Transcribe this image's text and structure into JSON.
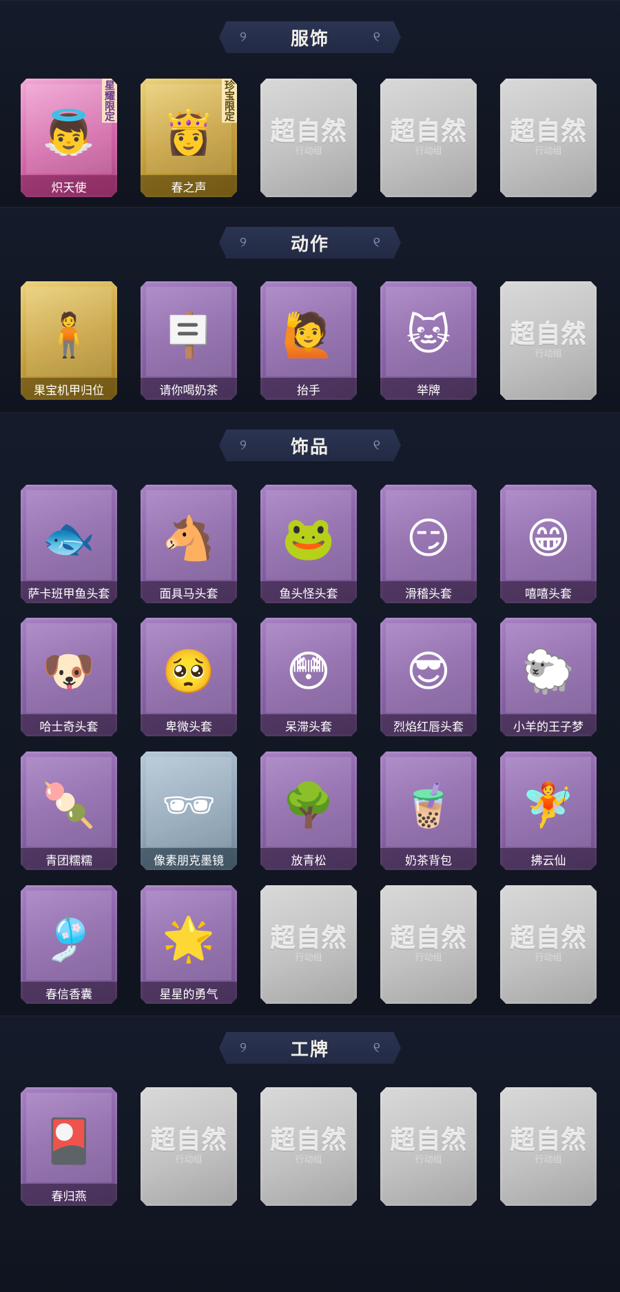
{
  "sections": [
    {
      "title": "服饰",
      "items": [
        {
          "label": "炽天使",
          "rarity": "pink",
          "badge": "星耀限定",
          "icon": "angel-portrait-icon",
          "glyph": "👼"
        },
        {
          "label": "春之声",
          "rarity": "gold",
          "badge": "珍宝限定",
          "icon": "golden-lady-portrait-icon",
          "glyph": "👸"
        },
        {
          "empty": true,
          "placeholder_title": "超自然",
          "placeholder_sub": "行动组"
        },
        {
          "empty": true,
          "placeholder_title": "超自然",
          "placeholder_sub": "行动组"
        },
        {
          "empty": true,
          "placeholder_title": "超自然",
          "placeholder_sub": "行动组"
        }
      ]
    },
    {
      "title": "动作",
      "items": [
        {
          "label": "果宝机甲归位",
          "rarity": "gold",
          "icon": "pose-figure-icon",
          "glyph": "🧍"
        },
        {
          "label": "请你喝奶茶",
          "rarity": "purple",
          "icon": "sign-holding-figure-icon",
          "glyph": "🪧"
        },
        {
          "label": "抬手",
          "rarity": "purple",
          "icon": "raised-hand-figure-icon",
          "glyph": "🙋"
        },
        {
          "label": "举牌",
          "rarity": "purple",
          "icon": "cat-sign-figure-icon",
          "glyph": "🐱"
        },
        {
          "empty": true,
          "placeholder_title": "超自然",
          "placeholder_sub": "行动组"
        }
      ]
    },
    {
      "title": "饰品",
      "items": [
        {
          "label": "萨卡班甲鱼头套",
          "rarity": "purple",
          "icon": "fish-head-icon",
          "glyph": "🐟"
        },
        {
          "label": "面具马头套",
          "rarity": "purple",
          "icon": "horse-mask-icon",
          "glyph": "🐴"
        },
        {
          "label": "鱼头怪头套",
          "rarity": "purple",
          "icon": "fish-monster-head-icon",
          "glyph": "🐸"
        },
        {
          "label": "滑稽头套",
          "rarity": "purple",
          "icon": "funny-face-icon",
          "glyph": "😏"
        },
        {
          "label": "嘻嘻头套",
          "rarity": "purple",
          "icon": "grin-face-icon",
          "glyph": "😁"
        },
        {
          "label": "哈士奇头套",
          "rarity": "purple",
          "icon": "husky-sunglasses-icon",
          "glyph": "🐶"
        },
        {
          "label": "卑微头套",
          "rarity": "purple",
          "icon": "pleading-face-icon",
          "glyph": "🥺"
        },
        {
          "label": "呆滞头套",
          "rarity": "purple",
          "icon": "dazed-face-icon",
          "glyph": "😳"
        },
        {
          "label": "烈焰红唇头套",
          "rarity": "purple",
          "icon": "pikachu-sunglasses-icon",
          "glyph": "😎"
        },
        {
          "label": "小羊的王子梦",
          "rarity": "purple",
          "icon": "crowned-sheep-icon",
          "glyph": "🐑"
        },
        {
          "label": "青团糯糯",
          "rarity": "purple",
          "icon": "green-rice-ball-icon",
          "glyph": "🍡"
        },
        {
          "label": "像素朋克墨镜",
          "rarity": "blue",
          "icon": "pixel-sunglasses-icon",
          "glyph": "🕶"
        },
        {
          "label": "放青松",
          "rarity": "purple",
          "icon": "potted-pine-icon",
          "glyph": "🌳"
        },
        {
          "label": "奶茶背包",
          "rarity": "purple",
          "icon": "milk-tea-bag-icon",
          "glyph": "🧋"
        },
        {
          "label": "拂云仙",
          "rarity": "purple",
          "icon": "cloud-fairy-charm-icon",
          "glyph": "🧚"
        },
        {
          "label": "春信香囊",
          "rarity": "purple",
          "icon": "sachet-icon",
          "glyph": "🎐"
        },
        {
          "label": "星星的勇气",
          "rarity": "purple",
          "icon": "star-charm-icon",
          "glyph": "🌟"
        },
        {
          "empty": true,
          "placeholder_title": "超自然",
          "placeholder_sub": "行动组"
        },
        {
          "empty": true,
          "placeholder_title": "超自然",
          "placeholder_sub": "行动组"
        },
        {
          "empty": true,
          "placeholder_title": "超自然",
          "placeholder_sub": "行动组"
        }
      ]
    },
    {
      "title": "工牌",
      "items": [
        {
          "label": "春归燕",
          "rarity": "purple",
          "icon": "pink-card-icon",
          "glyph": "🎴"
        },
        {
          "empty": true,
          "placeholder_title": "超自然",
          "placeholder_sub": "行动组"
        },
        {
          "empty": true,
          "placeholder_title": "超自然",
          "placeholder_sub": "行动组"
        },
        {
          "empty": true,
          "placeholder_title": "超自然",
          "placeholder_sub": "行动组"
        },
        {
          "empty": true,
          "placeholder_title": "超自然",
          "placeholder_sub": "行动组"
        }
      ]
    }
  ],
  "colors": {
    "background": "#111623",
    "header_bg": "#2b3452",
    "purple_card": "#8a63a8",
    "gold_card": "#c7a03c",
    "pink_card": "#d266a8",
    "blue_card": "#8ea4b6",
    "empty_card": "#c2c2c2"
  }
}
